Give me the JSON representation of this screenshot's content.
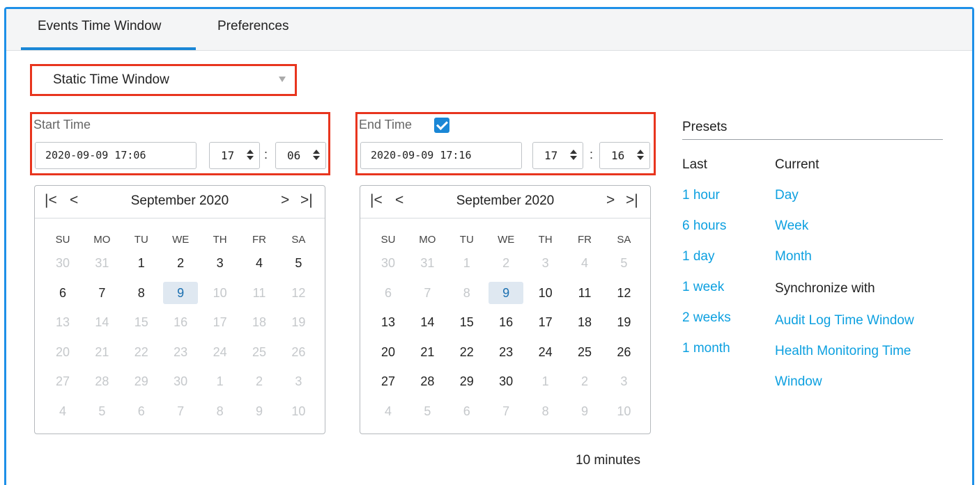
{
  "tabs": [
    {
      "label": "Events Time Window",
      "active": true
    },
    {
      "label": "Preferences",
      "active": false
    }
  ],
  "mode": {
    "selected": "Static Time Window"
  },
  "start": {
    "label": "Start Time",
    "datetime": "2020-09-09 17:06",
    "hour": "17",
    "minute": "06",
    "colon": ":"
  },
  "end": {
    "label": "End Time",
    "enabled": true,
    "datetime": "2020-09-09 17:16",
    "hour": "17",
    "minute": "16",
    "colon": ":"
  },
  "calendar_nav": {
    "first": "|<",
    "prev": "<",
    "next": ">",
    "last": ">|"
  },
  "weekdays": [
    "SU",
    "MO",
    "TU",
    "WE",
    "TH",
    "FR",
    "SA"
  ],
  "start_calendar": {
    "month": "September 2020",
    "selected_day": "9",
    "weeks": [
      [
        {
          "d": "30",
          "on": false
        },
        {
          "d": "31",
          "on": false
        },
        {
          "d": "1",
          "on": true
        },
        {
          "d": "2",
          "on": true
        },
        {
          "d": "3",
          "on": true
        },
        {
          "d": "4",
          "on": true
        },
        {
          "d": "5",
          "on": true
        }
      ],
      [
        {
          "d": "6",
          "on": true
        },
        {
          "d": "7",
          "on": true
        },
        {
          "d": "8",
          "on": true
        },
        {
          "d": "9",
          "on": true,
          "sel": true
        },
        {
          "d": "10",
          "on": false
        },
        {
          "d": "11",
          "on": false
        },
        {
          "d": "12",
          "on": false
        }
      ],
      [
        {
          "d": "13",
          "on": false
        },
        {
          "d": "14",
          "on": false
        },
        {
          "d": "15",
          "on": false
        },
        {
          "d": "16",
          "on": false
        },
        {
          "d": "17",
          "on": false
        },
        {
          "d": "18",
          "on": false
        },
        {
          "d": "19",
          "on": false
        }
      ],
      [
        {
          "d": "20",
          "on": false
        },
        {
          "d": "21",
          "on": false
        },
        {
          "d": "22",
          "on": false
        },
        {
          "d": "23",
          "on": false
        },
        {
          "d": "24",
          "on": false
        },
        {
          "d": "25",
          "on": false
        },
        {
          "d": "26",
          "on": false
        }
      ],
      [
        {
          "d": "27",
          "on": false
        },
        {
          "d": "28",
          "on": false
        },
        {
          "d": "29",
          "on": false
        },
        {
          "d": "30",
          "on": false
        },
        {
          "d": "1",
          "on": false
        },
        {
          "d": "2",
          "on": false
        },
        {
          "d": "3",
          "on": false
        }
      ],
      [
        {
          "d": "4",
          "on": false
        },
        {
          "d": "5",
          "on": false
        },
        {
          "d": "6",
          "on": false
        },
        {
          "d": "7",
          "on": false
        },
        {
          "d": "8",
          "on": false
        },
        {
          "d": "9",
          "on": false
        },
        {
          "d": "10",
          "on": false
        }
      ]
    ]
  },
  "end_calendar": {
    "month": "September 2020",
    "selected_day": "9",
    "weeks": [
      [
        {
          "d": "30",
          "on": false
        },
        {
          "d": "31",
          "on": false
        },
        {
          "d": "1",
          "on": false
        },
        {
          "d": "2",
          "on": false
        },
        {
          "d": "3",
          "on": false
        },
        {
          "d": "4",
          "on": false
        },
        {
          "d": "5",
          "on": false
        }
      ],
      [
        {
          "d": "6",
          "on": false
        },
        {
          "d": "7",
          "on": false
        },
        {
          "d": "8",
          "on": false
        },
        {
          "d": "9",
          "on": true,
          "sel": true
        },
        {
          "d": "10",
          "on": true
        },
        {
          "d": "11",
          "on": true
        },
        {
          "d": "12",
          "on": true
        }
      ],
      [
        {
          "d": "13",
          "on": true
        },
        {
          "d": "14",
          "on": true
        },
        {
          "d": "15",
          "on": true
        },
        {
          "d": "16",
          "on": true
        },
        {
          "d": "17",
          "on": true
        },
        {
          "d": "18",
          "on": true
        },
        {
          "d": "19",
          "on": true
        }
      ],
      [
        {
          "d": "20",
          "on": true
        },
        {
          "d": "21",
          "on": true
        },
        {
          "d": "22",
          "on": true
        },
        {
          "d": "23",
          "on": true
        },
        {
          "d": "24",
          "on": true
        },
        {
          "d": "25",
          "on": true
        },
        {
          "d": "26",
          "on": true
        }
      ],
      [
        {
          "d": "27",
          "on": true
        },
        {
          "d": "28",
          "on": true
        },
        {
          "d": "29",
          "on": true
        },
        {
          "d": "30",
          "on": true
        },
        {
          "d": "1",
          "on": false
        },
        {
          "d": "2",
          "on": false
        },
        {
          "d": "3",
          "on": false
        }
      ],
      [
        {
          "d": "4",
          "on": false
        },
        {
          "d": "5",
          "on": false
        },
        {
          "d": "6",
          "on": false
        },
        {
          "d": "7",
          "on": false
        },
        {
          "d": "8",
          "on": false
        },
        {
          "d": "9",
          "on": false
        },
        {
          "d": "10",
          "on": false
        }
      ]
    ]
  },
  "presets": {
    "title": "Presets",
    "last_header": "Last",
    "current_header": "Current",
    "last": [
      "1 hour",
      "6 hours",
      "1 day",
      "1 week",
      "2 weeks",
      "1 month"
    ],
    "current": [
      "Day",
      "Week",
      "Month"
    ],
    "sync_label": "Synchronize with",
    "sync_audit": "Audit Log Time Window",
    "sync_health_1": "Health Monitoring Time",
    "sync_health_2": "Window"
  },
  "duration": "10 minutes",
  "colors": {
    "accent": "#1a87d6",
    "link": "#0da0e0",
    "highlight_border": "#e8351e",
    "frame": "#1e90e8"
  }
}
